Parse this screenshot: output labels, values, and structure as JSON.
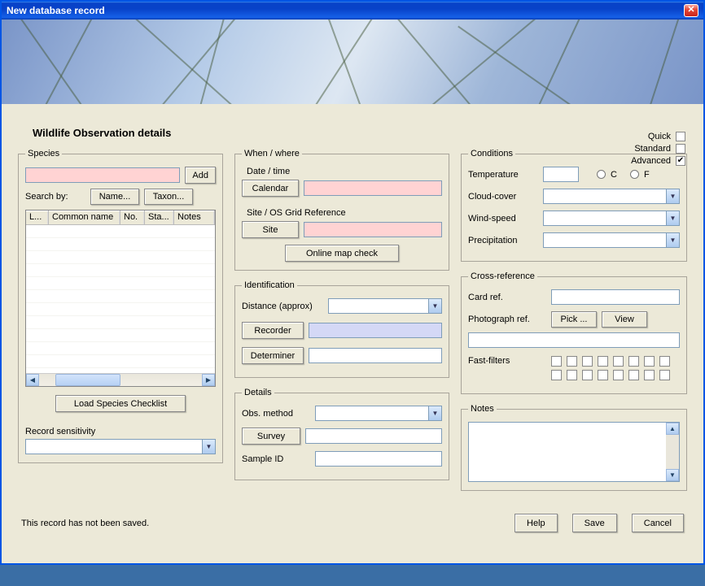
{
  "window": {
    "title": "New database record"
  },
  "modes": {
    "quick": {
      "label": "Quick",
      "checked": false
    },
    "standard": {
      "label": "Standard",
      "checked": false
    },
    "advanced": {
      "label": "Advanced",
      "checked": true
    }
  },
  "heading": "Wildlife Observation details",
  "species": {
    "legend": "Species",
    "add": "Add",
    "search_by": "Search by:",
    "name_btn": "Name...",
    "taxon_btn": "Taxon...",
    "columns": [
      "L...",
      "Common name",
      "No.",
      "Sta...",
      "Notes"
    ],
    "load_checklist": "Load Species Checklist",
    "sensitivity_label": "Record sensitivity"
  },
  "when": {
    "legend": "When / where",
    "datetime_label": "Date / time",
    "calendar": "Calendar",
    "site_label": "Site / OS Grid Reference",
    "site_btn": "Site",
    "map_check": "Online map check"
  },
  "ident": {
    "legend": "Identification",
    "distance_label": "Distance (approx)",
    "recorder_btn": "Recorder",
    "determiner_btn": "Determiner"
  },
  "details": {
    "legend": "Details",
    "obs_method": "Obs. method",
    "survey_btn": "Survey",
    "sample_id": "Sample ID"
  },
  "conditions": {
    "legend": "Conditions",
    "temperature": "Temperature",
    "unit_c": "C",
    "unit_f": "F",
    "cloud": "Cloud-cover",
    "wind": "Wind-speed",
    "precip": "Precipitation"
  },
  "xref": {
    "legend": "Cross-reference",
    "card_ref": "Card ref.",
    "photo_ref": "Photograph ref.",
    "pick": "Pick ...",
    "view": "View",
    "fast_filters": "Fast-filters"
  },
  "notes": {
    "legend": "Notes"
  },
  "footer": {
    "status": "This record has not been saved.",
    "help": "Help",
    "save": "Save",
    "cancel": "Cancel"
  }
}
